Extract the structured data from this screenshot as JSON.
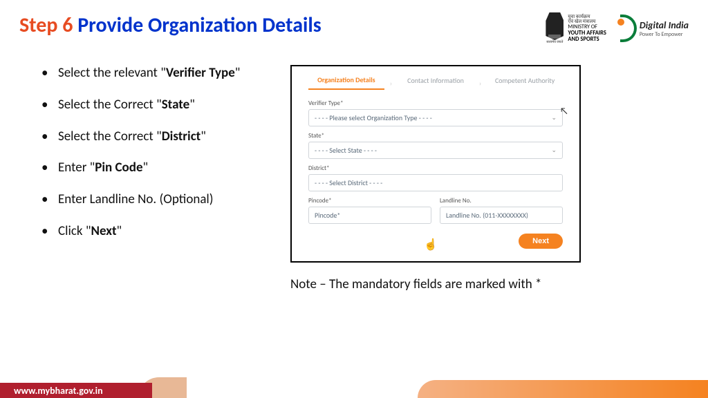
{
  "title": {
    "step": "Step 6 ",
    "rest": "Provide Organization Details"
  },
  "logos": {
    "ministry_hi": "युवा कार्यक्रम\nएवं खेल मंत्रालय",
    "ministry_line1": "MINISTRY OF",
    "ministry_line2": "YOUTH AFFAIRS",
    "ministry_line3": "AND SPORTS",
    "emblem_caption": "सत्यमेव जयते",
    "digital_india": "Digital India",
    "digital_india_sub": "Power To Empower"
  },
  "bullets": [
    {
      "pre": "Select the relevant \"",
      "bold": "Verifier Type",
      "post": "\""
    },
    {
      "pre": "Select the Correct \"",
      "bold": "State",
      "post": "\""
    },
    {
      "pre": "Select the Correct \"",
      "bold": "District",
      "post": "\""
    },
    {
      "pre": "Enter \"",
      "bold": "Pin Code",
      "post": "\""
    },
    {
      "pre": "Enter Landline No. (Optional)",
      "bold": "",
      "post": ""
    },
    {
      "pre": "Click \"",
      "bold": "Next",
      "post": "\""
    }
  ],
  "form": {
    "tabs": {
      "t1": "Organization Details",
      "t2": "Contact Information",
      "t3": "Competent Authority"
    },
    "labels": {
      "verifier": "Verifier Type*",
      "state": "State*",
      "district": "District*",
      "pincode": "Pincode*",
      "landline": "Landline No."
    },
    "placeholders": {
      "verifier": "- - - - Please select Organization Type - - - -",
      "state": "- - - - Select State - - - -",
      "district": "- - - - Select District - - - -",
      "pincode": "Pincode*",
      "landline": "Landline No. (011-XXXXXXXX)"
    },
    "next": "Next"
  },
  "note": "Note – The mandatory fields are marked with *",
  "footer_url": "www.mybharat.gov.in"
}
